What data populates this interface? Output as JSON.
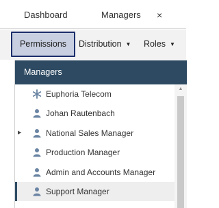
{
  "tabs": {
    "dashboard_label": "Dashboard",
    "managers_label": "Managers",
    "close_glyph": "×"
  },
  "toolbar": {
    "permissions_label": "Permissions",
    "distribution_label": "Distribution",
    "roles_label": "Roles",
    "caret_glyph": "▼"
  },
  "panel": {
    "header": "Managers",
    "items": [
      {
        "label": "Euphoria Telecom",
        "icon": "asterisk-icon"
      },
      {
        "label": "Johan Rautenbach",
        "icon": "user-icon"
      },
      {
        "label": "National Sales Manager",
        "icon": "user-icon",
        "expander": "▶"
      },
      {
        "label": "Production Manager",
        "icon": "user-icon"
      },
      {
        "label": "Admin and Accounts Manager",
        "icon": "user-icon"
      },
      {
        "label": "Support Manager",
        "icon": "user-icon",
        "selected": true
      }
    ]
  },
  "scrollbar": {
    "up_glyph": "▲"
  },
  "colors": {
    "accent": "#2d4a62",
    "selected_button_bg": "#c8cfe0",
    "selected_button_border": "#1b2e6a",
    "icon": "#6a84a3"
  }
}
